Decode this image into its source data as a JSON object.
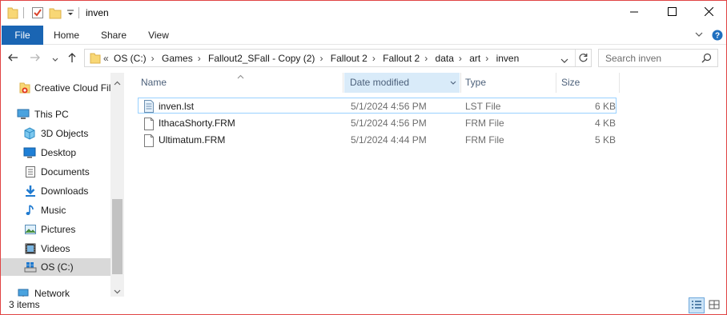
{
  "window": {
    "title": "inven",
    "controls": {
      "minimize": "minimize-icon",
      "maximize": "maximize-icon",
      "close": "close-icon"
    }
  },
  "ribbon": {
    "tabs": [
      "File",
      "Home",
      "Share",
      "View"
    ],
    "expand_icon": "chevron-down-icon",
    "help_icon": "help-icon"
  },
  "address": {
    "overflow": "«",
    "crumbs": [
      "OS (C:)",
      "Games",
      "Fallout2_SFall - Copy (2)",
      "Fallout 2",
      "Fallout 2",
      "data",
      "art",
      "inven"
    ],
    "separator": "›"
  },
  "search": {
    "placeholder": "Search inven"
  },
  "nav": {
    "items": [
      {
        "label": "Creative Cloud Files",
        "icon": "creative-cloud-icon"
      },
      {
        "label": "This PC",
        "icon": "computer-icon"
      },
      {
        "label": "3D Objects",
        "icon": "3d-objects-icon"
      },
      {
        "label": "Desktop",
        "icon": "desktop-icon"
      },
      {
        "label": "Documents",
        "icon": "documents-icon"
      },
      {
        "label": "Downloads",
        "icon": "downloads-icon"
      },
      {
        "label": "Music",
        "icon": "music-icon"
      },
      {
        "label": "Pictures",
        "icon": "pictures-icon"
      },
      {
        "label": "Videos",
        "icon": "videos-icon"
      },
      {
        "label": "OS (C:)",
        "icon": "drive-icon"
      },
      {
        "label": "Network",
        "icon": "network-icon"
      }
    ],
    "selected": "OS (C:)"
  },
  "columns": {
    "name": "Name",
    "date": "Date modified",
    "type": "Type",
    "size": "Size"
  },
  "files": [
    {
      "name": "inven.lst",
      "date": "5/1/2024 4:56 PM",
      "type": "LST File",
      "size": "6 KB"
    },
    {
      "name": "IthacaShorty.FRM",
      "date": "5/1/2024 4:56 PM",
      "type": "FRM File",
      "size": "4 KB"
    },
    {
      "name": "Ultimatum.FRM",
      "date": "5/1/2024 4:44 PM",
      "type": "FRM File",
      "size": "5 KB"
    }
  ],
  "status": {
    "count": "3 items"
  },
  "colors": {
    "accent": "#1a65b3",
    "selection_border": "#99d1ff",
    "sorted_header": "#d9ebf9",
    "window_border": "#e04343"
  }
}
